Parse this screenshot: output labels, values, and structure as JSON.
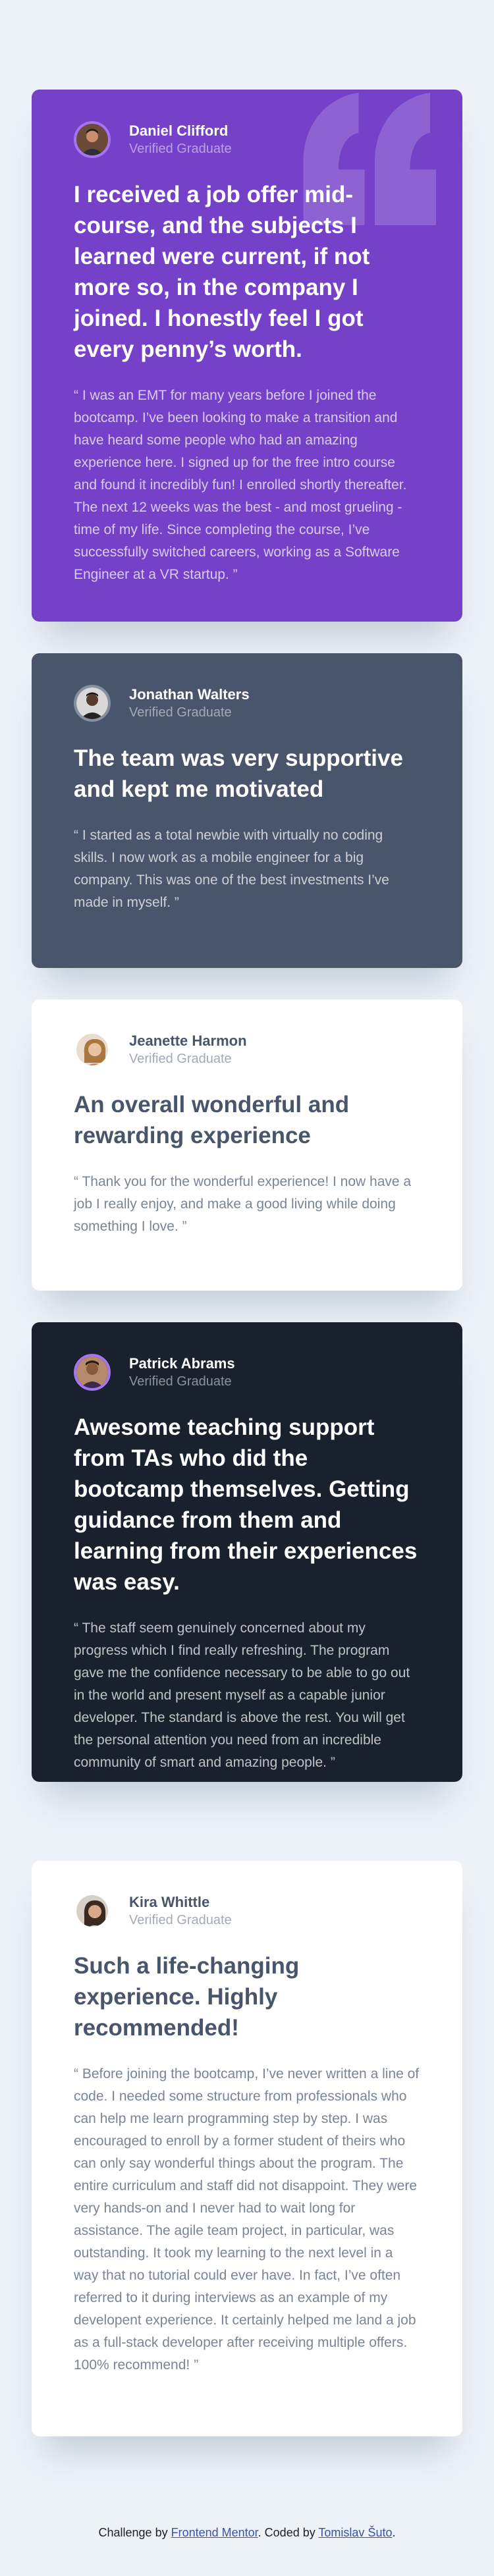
{
  "testimonials": [
    {
      "name": "Daniel Clifford",
      "role": "Verified Graduate",
      "headline": "I received a job offer mid-course, and the subjects I learned were current, if not more so, in the company I joined. I honestly feel I got every penny’s worth.",
      "body": "“ I was an EMT for many years before I joined the bootcamp. I’ve been looking to make a transition and have heard some people who had an amazing experience here. I signed up for the free intro course and found it incredibly fun! I enrolled shortly thereafter. The next 12 weeks was the best - and most grueling - time of my life. Since completing the course, I’ve successfully switched careers, working as a Software Engineer at a VR startup. ”"
    },
    {
      "name": "Jonathan Walters",
      "role": "Verified Graduate",
      "headline": "The team was very supportive and kept me motivated",
      "body": "“ I started as a total newbie with virtually no coding skills. I now work as a mobile engineer for a big company. This was one of the best investments I’ve made in myself. ”"
    },
    {
      "name": "Jeanette Harmon",
      "role": "Verified Graduate",
      "headline": "An overall wonderful and rewarding experience",
      "body": "“ Thank you for the wonderful experience! I now have a job I really enjoy, and make a good living while doing something I love. ”"
    },
    {
      "name": "Patrick Abrams",
      "role": "Verified Graduate",
      "headline": "Awesome teaching support from TAs who did the bootcamp themselves. Getting guidance from them and learning from their experiences was easy.",
      "body": "“ The staff seem genuinely concerned about my progress which I find really refreshing. The program gave me the confidence necessary to be able to go out in the world and present myself as a capable junior developer. The standard is above the rest. You will get the personal attention you need from an incredible community of smart and amazing people. ”"
    },
    {
      "name": "Kira Whittle",
      "role": "Verified Graduate",
      "headline": "Such a life-changing experience. Highly recommended!",
      "body": "“ Before joining the bootcamp, I’ve never written a line of code. I needed some structure from professionals who can help me learn programming step by step. I was encouraged to enroll by a former student of theirs who can only say wonderful things about the program. The entire curriculum and staff did not disappoint. They were very hands-on and I never had to wait long for assistance. The agile team project, in particular, was outstanding. It took my learning to the next level in a way that no tutorial could ever have. In fact, I’ve often referred to it during interviews as an example of my developent experience. It certainly helped me land a job as a full-stack developer after receiving multiple offers. 100% recommend! ”"
    }
  ],
  "footer": {
    "prefix": "Challenge by",
    "link1": "Frontend Mentor",
    "middle": ". Coded by",
    "link2": "Tomislav Šuto",
    "suffix": "."
  },
  "colors": {
    "purple": "#7541C8",
    "grayblue": "#48556A",
    "white": "#FFFFFF",
    "darkblue": "#19212E",
    "background": "#ECF2F8"
  }
}
